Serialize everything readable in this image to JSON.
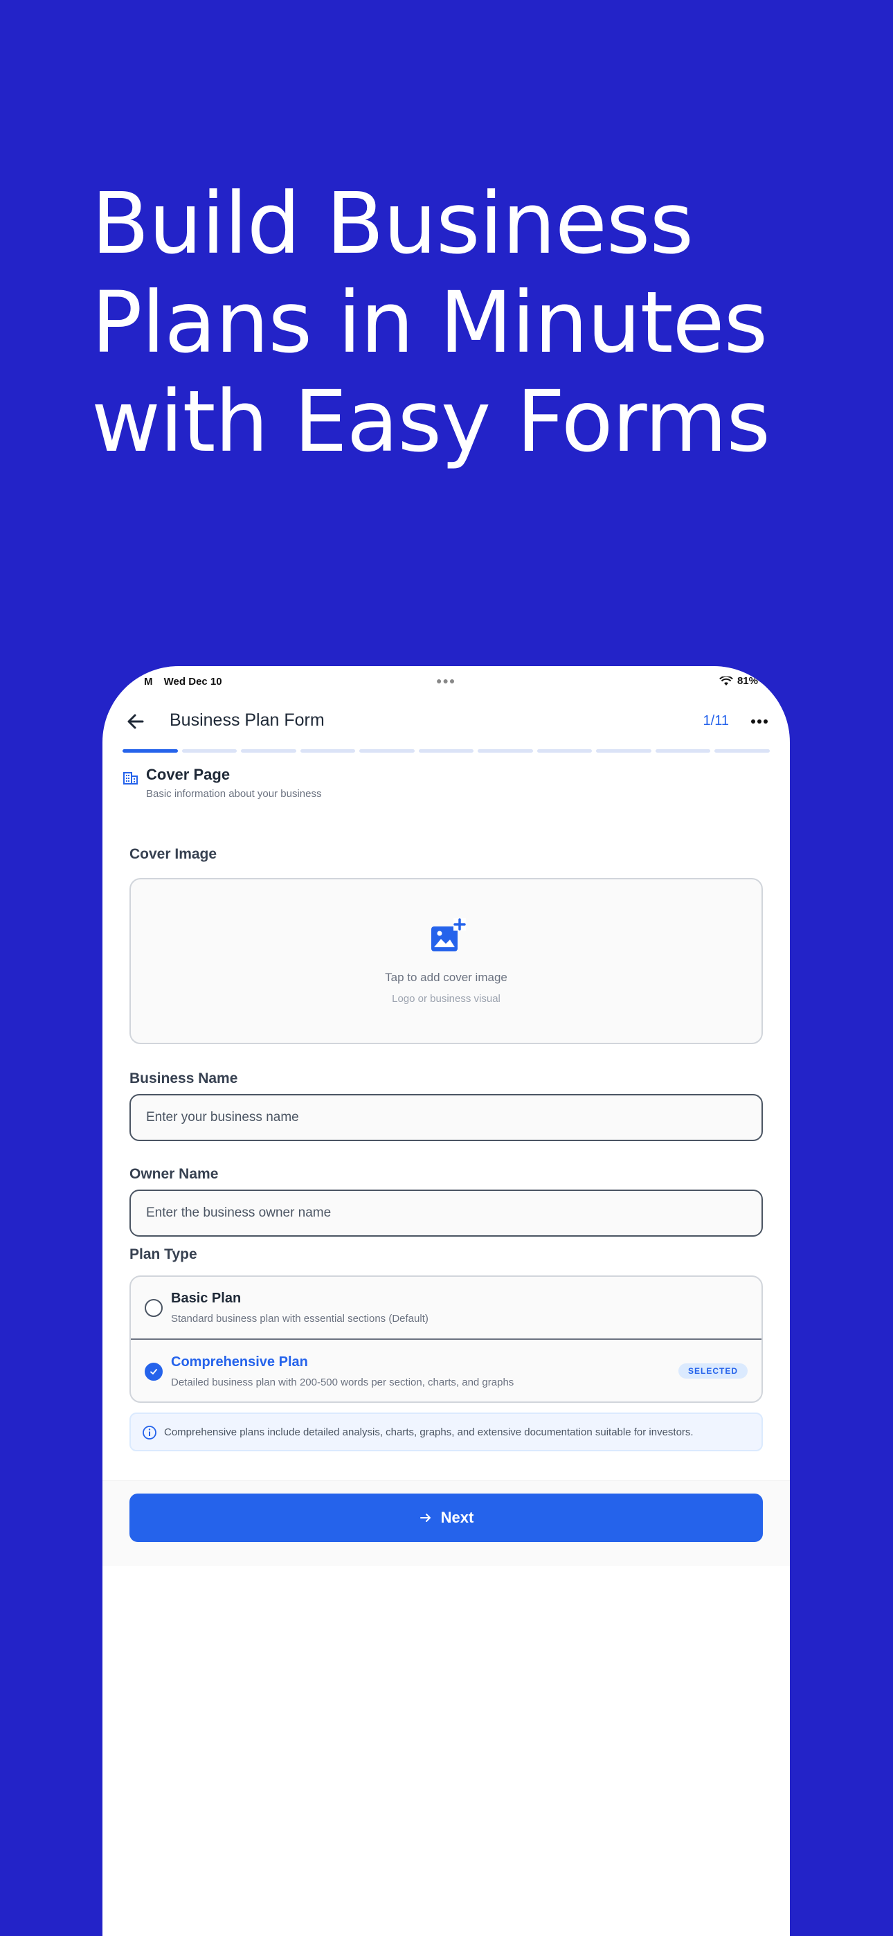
{
  "headline": {
    "line1": "Build Business",
    "line2": "Plans in Minutes",
    "line3": "with Easy Forms"
  },
  "status_bar": {
    "carrier": "M",
    "date": "Wed Dec 10",
    "battery": "81%"
  },
  "nav": {
    "title": "Business Plan Form",
    "progress": "1/11"
  },
  "progress_steps": {
    "total": 11,
    "current": 1
  },
  "section": {
    "title": "Cover Page",
    "subtitle": "Basic information about your business"
  },
  "cover_image": {
    "label": "Cover Image",
    "prompt": "Tap to add cover image",
    "hint": "Logo or business visual"
  },
  "business_name": {
    "label": "Business Name",
    "placeholder": "Enter your business name",
    "value": ""
  },
  "owner_name": {
    "label": "Owner Name",
    "placeholder": "Enter the business owner name",
    "value": ""
  },
  "plan_type": {
    "label": "Plan Type",
    "options": [
      {
        "name": "Basic Plan",
        "description": "Standard business plan with essential sections (Default)",
        "selected": false
      },
      {
        "name": "Comprehensive Plan",
        "description": "Detailed business plan with 200-500 words per section, charts, and graphs",
        "selected": true,
        "badge": "SELECTED"
      }
    ]
  },
  "info": {
    "text": "Comprehensive plans include detailed analysis, charts, graphs, and extensive documentation suitable for investors."
  },
  "footer": {
    "next_label": "Next"
  },
  "colors": {
    "background": "#2323c8",
    "accent": "#2563eb"
  }
}
